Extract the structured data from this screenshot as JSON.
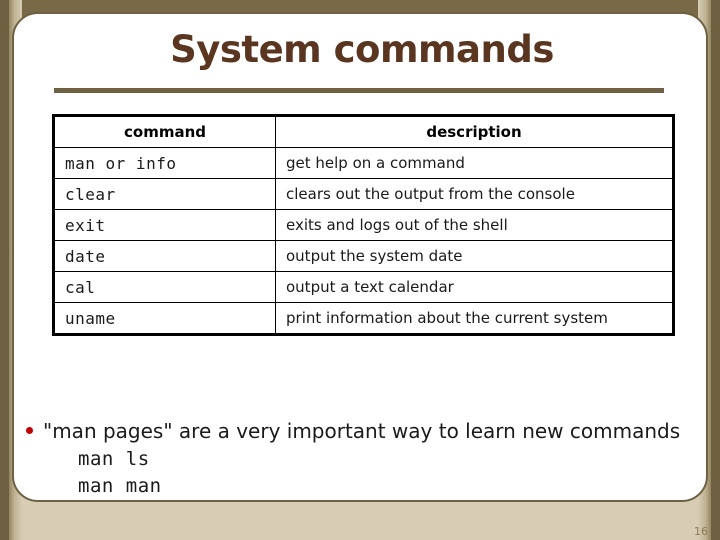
{
  "slide": {
    "title": "System commands",
    "number": "16",
    "colors": {
      "frame_dark": "#6f6041",
      "frame_mid": "#7a6947",
      "frame_tan": "#d6cdb4",
      "title_text": "#5a3620",
      "bullet_dot": "#c00000",
      "panel_background": "#ffffff",
      "table_border": "#000000"
    }
  },
  "table": {
    "headers": [
      "command",
      "description"
    ],
    "rows": [
      {
        "command": "man  or  info",
        "description": "get help on a command"
      },
      {
        "command": "clear",
        "description": "clears out the output from the console"
      },
      {
        "command": "exit",
        "description": "exits and logs out of the shell"
      },
      {
        "command": "date",
        "description": "output the system date"
      },
      {
        "command": "cal",
        "description": "output a text calendar"
      },
      {
        "command": "uname",
        "description": "print information about the current system"
      }
    ]
  },
  "bullets": [
    {
      "text": "\"man pages\" are a very important way to learn new commands",
      "sub_lines": [
        "man ls",
        "man man"
      ]
    }
  ]
}
